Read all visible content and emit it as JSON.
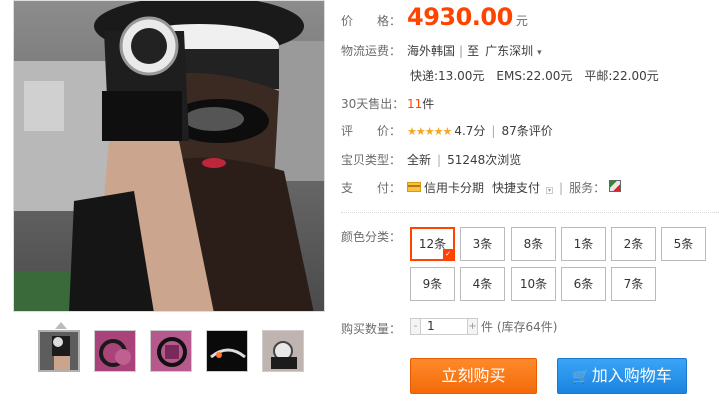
{
  "price": {
    "label": "价　　格：",
    "value": "4930.00",
    "unit": "元"
  },
  "shipping": {
    "label": "物流运费：",
    "origin": "海外韩国",
    "to_label": "至",
    "destination": "广东深圳",
    "express": "快递:13.00元",
    "ems": "EMS:22.00元",
    "post": "平邮:22.00元"
  },
  "sales": {
    "label": "30天售出：",
    "count": "11",
    "unit": "件"
  },
  "rating": {
    "label": "评　　价：",
    "stars": "★★★★★",
    "score": "4.7分",
    "reviews": "87条评价"
  },
  "item_type": {
    "label": "宝贝类型：",
    "condition": "全新",
    "views": "51248次浏览"
  },
  "payment": {
    "label": "支　　付：",
    "installment": "信用卡分期",
    "quick_pay": "快捷支付",
    "service_label": "服务："
  },
  "color": {
    "label": "颜色分类：",
    "options": [
      "12条",
      "3条",
      "8条",
      "1条",
      "2条",
      "5条",
      "9条",
      "4条",
      "10条",
      "6条",
      "7条"
    ],
    "selected": "12条"
  },
  "quantity": {
    "label": "购买数量：",
    "value": "1",
    "minus": "-",
    "plus": "+",
    "note": "件 (库存64件)"
  },
  "buttons": {
    "buy": "立刻购买",
    "cart": "加入购物车"
  },
  "colors": {
    "accent": "#ff4400",
    "buy": "#f36a0a",
    "cart": "#1b84e0"
  },
  "icons": {
    "thumb_arrow": "triangle-up",
    "cart": "shopping-cart-icon",
    "card": "credit-card-icon",
    "service": "service-icon"
  }
}
